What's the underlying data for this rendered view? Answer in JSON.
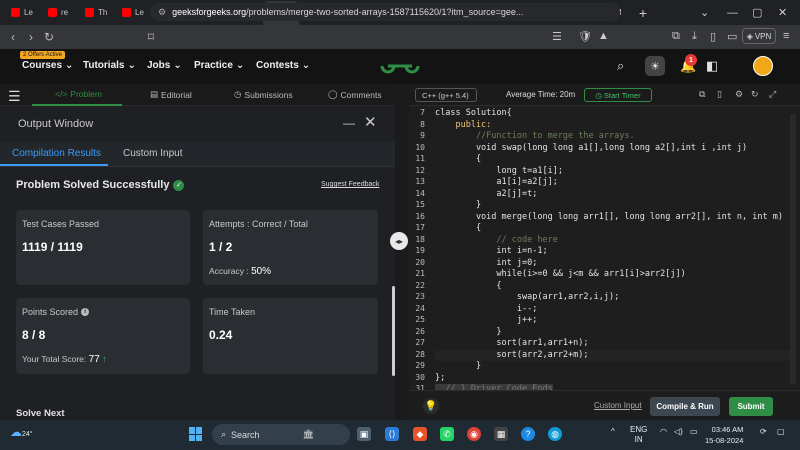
{
  "browser": {
    "tabs": [
      {
        "label": "Le",
        "color": "#ff0000"
      },
      {
        "label": "re",
        "color": "#ff0000"
      },
      {
        "label": "Th",
        "color": "#ff0000"
      },
      {
        "label": "Le",
        "color": "#ff0000"
      },
      {
        "label": "Li",
        "color": "#e53935"
      },
      {
        "label": "Cc",
        "color": "#e91e63"
      },
      {
        "label": "M",
        "color": "#2f8d46"
      },
      {
        "label": "To",
        "color": "#2f8d46"
      },
      {
        "label": "6.",
        "color": "#1565c0"
      },
      {
        "label": "Pl",
        "color": "#ffffff"
      },
      {
        "label": "Nc",
        "color": "#7e57c2"
      },
      {
        "label": "W",
        "color": "#2f8d46"
      },
      {
        "label": "(1",
        "color": "#ff0000"
      },
      {
        "label": "(1",
        "color": "#ff0000"
      },
      {
        "label": "Pr",
        "color": "#2f8d46"
      },
      {
        "label": "M",
        "color": "#f9a825"
      }
    ],
    "active_tab_label": "",
    "url_domain": "geeksforgeeks.org",
    "url_rest": "/problems/merge-two-sorted-arrays-1587115620/1?itm_source=gee...",
    "vpn_label": "VPN"
  },
  "header": {
    "offers_badge": "2 Offers Active",
    "nav": [
      "Courses",
      "Tutorials",
      "Jobs",
      "Practice",
      "Contests"
    ],
    "notification_count": "1"
  },
  "left_tabs": {
    "problem": "Problem",
    "editorial": "Editorial",
    "submissions": "Submissions",
    "comments": "Comments"
  },
  "output_window": {
    "title": "Output Window",
    "tabs": [
      "Compilation Results",
      "Custom Input"
    ],
    "status": "Problem Solved Successfully",
    "feedback_link": "Suggest Feedback",
    "cards": {
      "test_cases_label": "Test Cases Passed",
      "test_cases_value": "1119 / 1119",
      "attempts_label": "Attempts : Correct / Total",
      "attempts_value": "1 / 2",
      "accuracy_label": "Accuracy :",
      "accuracy_value": "50%",
      "points_label": "Points Scored",
      "points_value": "8 / 8",
      "total_score_label": "Your Total Score:",
      "total_score_value": "77",
      "time_label": "Time Taken",
      "time_value": "0.24"
    },
    "solve_next": "Solve Next"
  },
  "editor": {
    "language": "C++ (g++ 5.4)",
    "average_time": "Average Time: 20m",
    "start_timer": "Start Timer",
    "lines": [
      {
        "n": "7",
        "text": "class Solution{"
      },
      {
        "n": "8",
        "text": "    public:"
      },
      {
        "n": "9",
        "text": "        //Function to merge the arrays."
      },
      {
        "n": "10",
        "text": "        void swap(long long a1[],long long a2[],int i ,int j)"
      },
      {
        "n": "11",
        "text": "        {"
      },
      {
        "n": "12",
        "text": "            long t=a1[i];"
      },
      {
        "n": "13",
        "text": "            a1[i]=a2[j];"
      },
      {
        "n": "14",
        "text": "            a2[j]=t;"
      },
      {
        "n": "15",
        "text": "        }"
      },
      {
        "n": "16",
        "text": "        void merge(long long arr1[], long long arr2[], int n, int m)"
      },
      {
        "n": "17",
        "text": "        {"
      },
      {
        "n": "18",
        "text": "            // code here"
      },
      {
        "n": "19",
        "text": "            int i=n-1;"
      },
      {
        "n": "20",
        "text": "            int j=0;"
      },
      {
        "n": "21",
        "text": "            while(i>=0 && j<m && arr1[i]>arr2[j])"
      },
      {
        "n": "22",
        "text": "            {"
      },
      {
        "n": "23",
        "text": "                swap(arr1,arr2,i,j);"
      },
      {
        "n": "24",
        "text": "                i--;"
      },
      {
        "n": "25",
        "text": "                j++;"
      },
      {
        "n": "26",
        "text": "            }"
      },
      {
        "n": "27",
        "text": "            sort(arr1,arr1+n);"
      },
      {
        "n": "28",
        "text": "            sort(arr2,arr2+m);"
      },
      {
        "n": "29",
        "text": "        }"
      },
      {
        "n": "30",
        "text": "};"
      },
      {
        "n": "31",
        "text": "  // } Driver Code Ends"
      }
    ],
    "custom_input": "Custom Input",
    "compile_run": "Compile & Run",
    "submit": "Submit"
  },
  "taskbar": {
    "temperature": "24°",
    "search_placeholder": "Search",
    "lang_top": "ENG",
    "lang_bottom": "IN",
    "time": "03:46 AM",
    "date": "15-08-2024"
  }
}
